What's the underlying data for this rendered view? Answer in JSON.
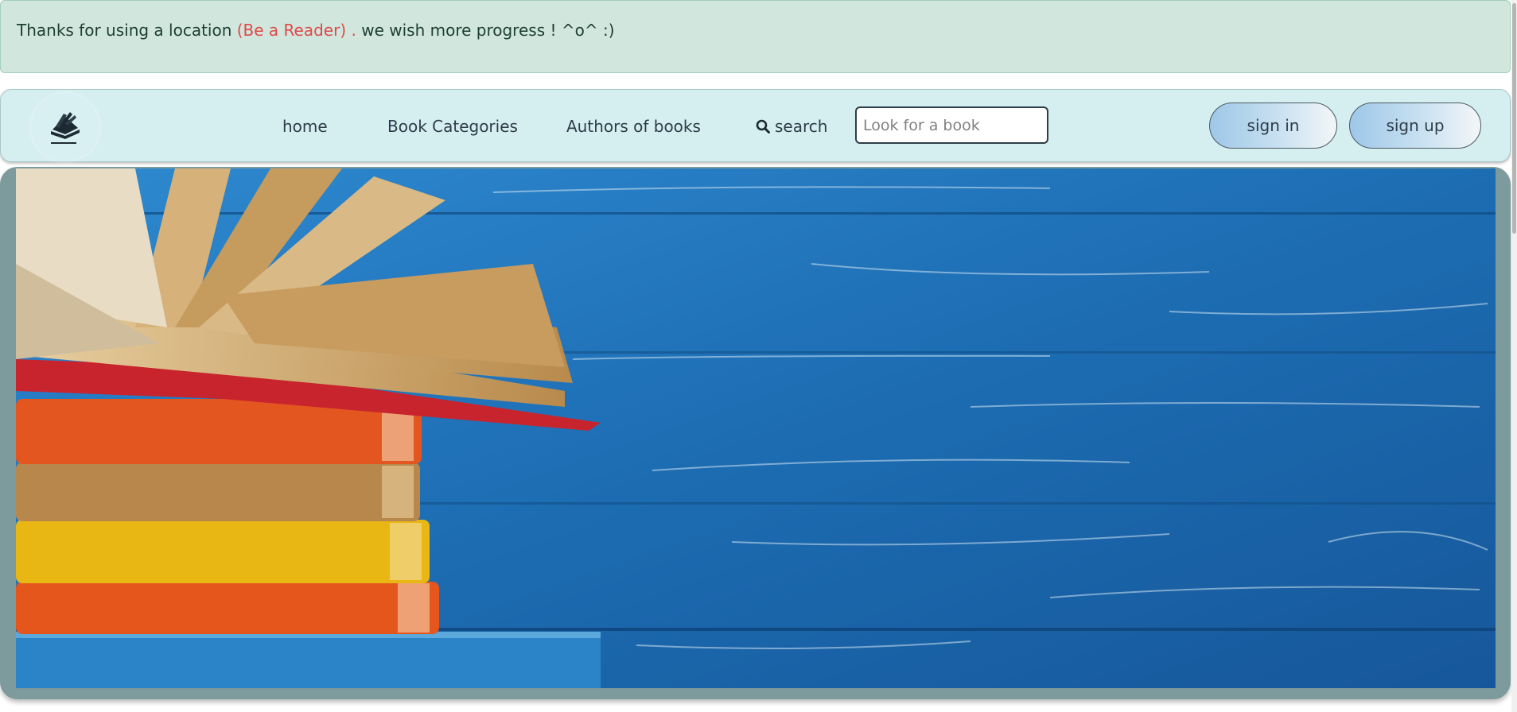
{
  "alert": {
    "text_before": "Thanks for using a location",
    "link_text": "(Be a Reader) .",
    "text_after": "we wish more progress ! ^o^ :)"
  },
  "navbar": {
    "logo_icon": "book-reader-icon",
    "links": {
      "home": "home",
      "categories": "Book Categories",
      "authors": "Authors of books",
      "search": "search"
    },
    "search_icon": "search-icon",
    "search_placeholder": "Look for a book",
    "signin_label": "sign in",
    "signup_label": "sign up"
  },
  "hero": {
    "image": "books-stack-on-blue-wood"
  },
  "colors": {
    "alert_bg": "#d1e7dd",
    "alert_link": "#e04848",
    "navbar_bg": "#d5eef0",
    "hero_frame": "#7d9a9c",
    "wood_blue": "#1e72b8"
  }
}
